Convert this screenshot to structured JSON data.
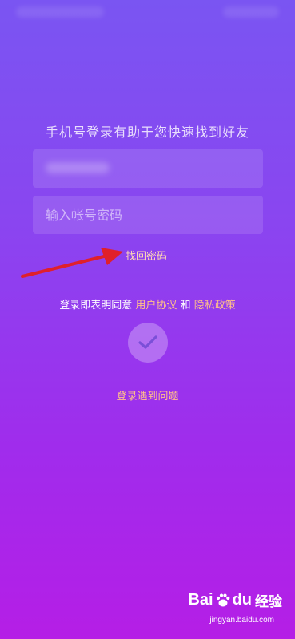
{
  "headline": "手机号登录有助于您快速找到好友",
  "password_field": {
    "placeholder": "输入帐号密码"
  },
  "forgot_password": "找回密码",
  "agreement": {
    "prefix": "登录即表明同意",
    "user_agreement": "用户协议",
    "conjunction": "和",
    "privacy_policy": "隐私政策"
  },
  "login_problem": "登录遇到问题",
  "watermark": {
    "brand_left": "Bai",
    "brand_right": "du",
    "brand_cn": "经验",
    "url": "jingyan.baidu.com"
  },
  "icons": {
    "submit": "check-icon",
    "annotation": "arrow-icon",
    "watermark": "paw-icon"
  },
  "colors": {
    "link": "#ffc08a",
    "arrow": "#e0202a"
  }
}
